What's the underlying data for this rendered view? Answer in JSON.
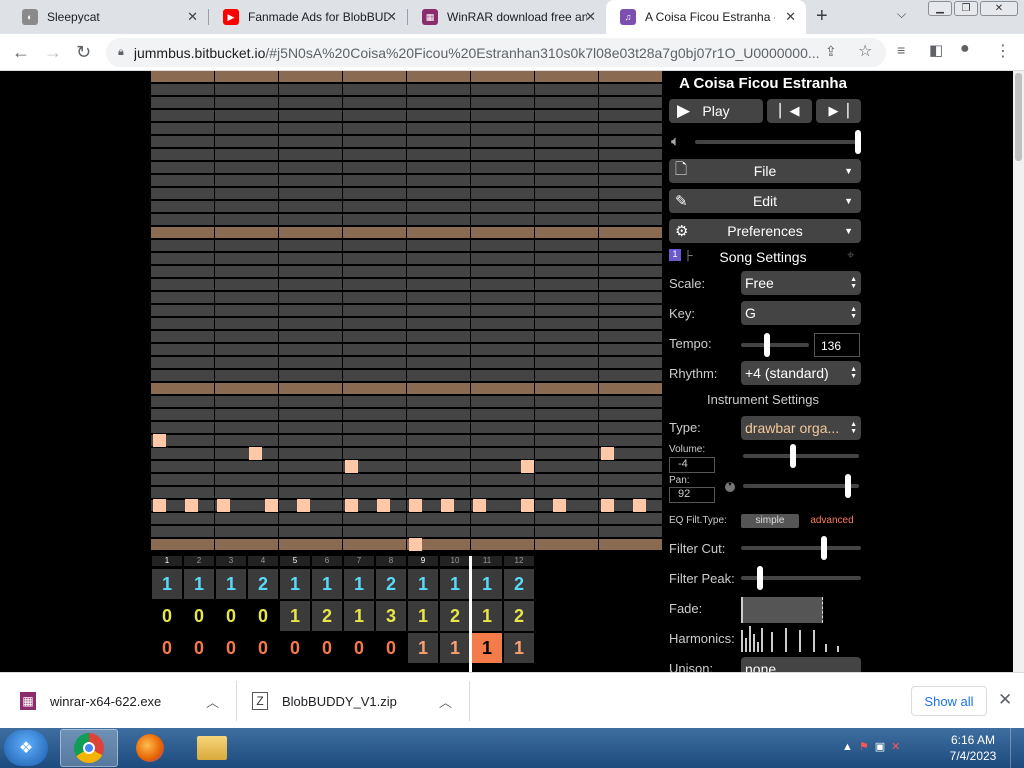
{
  "browser": {
    "tabs": [
      {
        "title": "Sleepycat",
        "icon": "cat-favicon",
        "color": "#7a7a7a"
      },
      {
        "title": "Fanmade Ads for BlobBUDDY",
        "icon": "youtube-favicon",
        "color": "#ff0000"
      },
      {
        "title": "WinRAR download free and",
        "icon": "winrar-favicon",
        "color": "#8b2c6c"
      },
      {
        "title": "A Coisa Ficou Estranha - J",
        "icon": "jummbox-favicon",
        "color": "#7d4fb0"
      }
    ],
    "url_host": "jummbus.bitbucket.io",
    "url_path": "/#j5N0sA%20Coisa%20Ficou%20Estranhan310s0k7l08e03t28a7g0bj07r1O_U0000000..."
  },
  "app": {
    "song_title": "A Coisa Ficou Estranha",
    "play_label": "Play",
    "menus": {
      "file": "File",
      "edit": "Edit",
      "preferences": "Preferences"
    },
    "song_settings": {
      "heading": "Song Settings",
      "scale_label": "Scale:",
      "scale_value": "Free",
      "key_label": "Key:",
      "key_value": "G",
      "tempo_label": "Tempo:",
      "tempo_value": "136",
      "rhythm_label": "Rhythm:",
      "rhythm_value": "+4 (standard)"
    },
    "instrument_settings": {
      "heading": "Instrument Settings",
      "type_label": "Type:",
      "type_value": "drawbar orga...",
      "volume_label": "Volume:",
      "volume_value": "-4",
      "pan_label": "Pan:",
      "pan_value": "92",
      "eq_label": "EQ Filt.Type:",
      "eq_simple": "simple",
      "eq_advanced": "advanced",
      "filter_cut_label": "Filter Cut:",
      "filter_peak_label": "Filter Peak:",
      "fade_label": "Fade:",
      "harmonics_label": "Harmonics:",
      "unison_label": "Unison:",
      "unison_value": "none"
    },
    "bar_numbers": [
      "1",
      "2",
      "3",
      "4",
      "5",
      "6",
      "7",
      "8",
      "9",
      "10",
      "11",
      "12"
    ],
    "pattern_rows": [
      {
        "color": "#5ad9f8",
        "values": [
          "1",
          "1",
          "1",
          "2",
          "1",
          "1",
          "1",
          "2",
          "1",
          "1",
          "1",
          "2"
        ]
      },
      {
        "color": "#e6e64a",
        "values": [
          "0",
          "0",
          "0",
          "0",
          "1",
          "2",
          "1",
          "3",
          "1",
          "2",
          "1",
          "2"
        ]
      },
      {
        "color": "#f47c4a",
        "values": [
          "0",
          "0",
          "0",
          "0",
          "0",
          "0",
          "0",
          "0",
          "1",
          "1",
          "1",
          "1"
        ]
      }
    ],
    "colors": {
      "note": "#ffc9a8",
      "highlight_row": "#8a6a50",
      "cell": "#444444"
    }
  },
  "downloads": {
    "items": [
      {
        "name": "winrar-x64-622.exe",
        "icon": "winrar-file-icon"
      },
      {
        "name": "BlobBUDDY_V1.zip",
        "icon": "zip-file-icon"
      }
    ],
    "show_all": "Show all"
  },
  "taskbar": {
    "time": "6:16 AM",
    "date": "7/4/2023"
  }
}
